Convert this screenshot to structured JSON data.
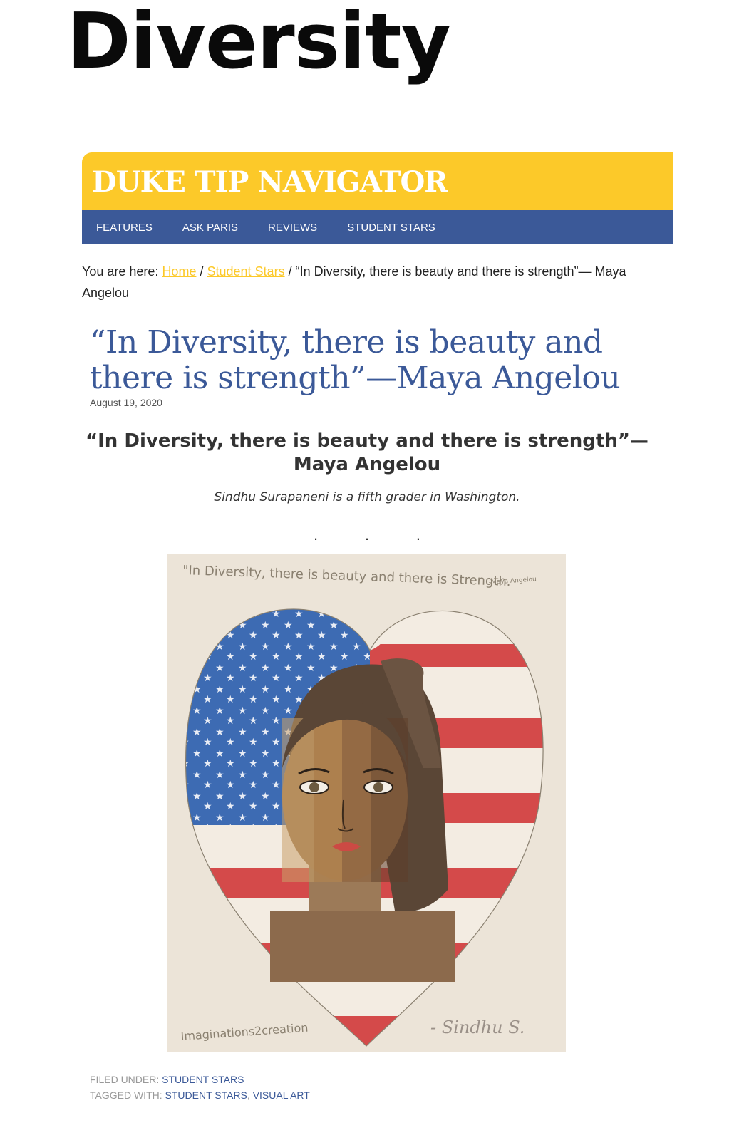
{
  "page_title": "Diversity",
  "site": {
    "title": "DUKE TIP NAVIGATOR",
    "accent_color": "#fcc929",
    "nav_color": "#3b5998"
  },
  "nav": {
    "items": [
      {
        "label": "FEATURES"
      },
      {
        "label": "ASK PARIS"
      },
      {
        "label": "REVIEWS"
      },
      {
        "label": "STUDENT STARS"
      }
    ]
  },
  "breadcrumb": {
    "prefix": "You are here:",
    "links": [
      "Home",
      "Student Stars"
    ],
    "separator": "/",
    "current": "“In Diversity, there is beauty and there is strength”— Maya Angelou"
  },
  "post": {
    "title": "“In Diversity, there is beauty and there is strength”—Maya Angelou",
    "date": "August 19, 2020",
    "heading": "“In Diversity, there is beauty and there is strength”— Maya Angelou",
    "byline": "Sindhu Surapaneni is a fifth grader in Washington.",
    "separator_dots": ".  .  ."
  },
  "artwork": {
    "quote_handwritten": "\"In Diversity, there is beauty and there is Strength.",
    "attribution_handwritten": "-Maya Angelou",
    "watermark": "Imaginations2creation",
    "signature": "- Sindhu S."
  },
  "footer": {
    "filed_label": "FILED UNDER:",
    "filed_links": [
      "STUDENT STARS"
    ],
    "tagged_label": "TAGGED WITH:",
    "tagged_links": [
      "STUDENT STARS",
      "VISUAL ART"
    ]
  }
}
